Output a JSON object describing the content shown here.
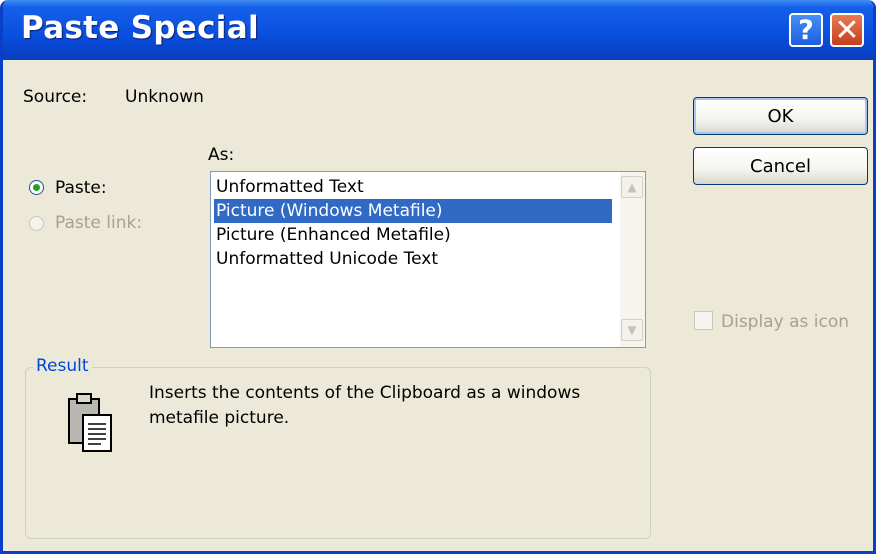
{
  "titlebar": {
    "title": "Paste Special"
  },
  "source": {
    "label": "Source:",
    "value": "Unknown"
  },
  "as_label": "As:",
  "options": {
    "paste_label": "Paste:",
    "paste_link_label": "Paste link:",
    "selected": "Paste"
  },
  "format_list": {
    "items": [
      "Unformatted Text",
      "Picture (Windows Metafile)",
      "Picture (Enhanced Metafile)",
      "Unformatted Unicode Text"
    ],
    "selected_index": 1
  },
  "buttons": {
    "ok": "OK",
    "cancel": "Cancel"
  },
  "display_as_icon": {
    "label": "Display as icon",
    "checked": false,
    "enabled": false
  },
  "result": {
    "group_label": "Result",
    "line1": "Inserts the contents of the Clipboard as a windows",
    "line2": "metafile picture."
  },
  "icons": [
    "help-icon",
    "close-icon",
    "scroll-up-icon",
    "scroll-down-icon",
    "clipboard-icon"
  ],
  "colors": {
    "title_bar": "#0A50E0",
    "dialog_bg": "#ECE9D8",
    "selection": "#316AC5",
    "close_button": "#D85A33"
  }
}
